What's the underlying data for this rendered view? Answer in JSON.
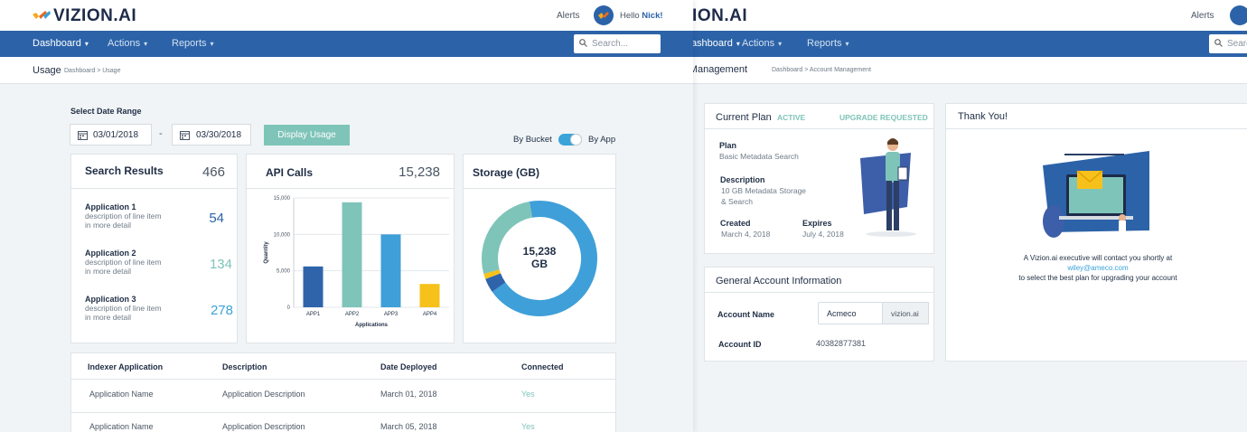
{
  "left": {
    "brand": "VIZION.AI",
    "alerts": "Alerts",
    "greeting_prefix": "Hello ",
    "greeting_name": "Nick!",
    "nav": [
      "Dashboard",
      "Actions",
      "Reports"
    ],
    "search_placeholder": "Search...",
    "page_title": "Usage",
    "breadcrumb": "Dashboard > Usage",
    "date_range_label": "Select Date Range",
    "date_start": "03/01/2018",
    "date_sep": "-",
    "date_end": "03/30/2018",
    "display_button": "Display Usage",
    "toggle_left": "By Bucket",
    "toggle_right": "By App",
    "search_results": {
      "title": "Search Results",
      "total": "466",
      "items": [
        {
          "name": "Application 1",
          "desc1": "description of line item",
          "desc2": "in more detail",
          "value": "54"
        },
        {
          "name": "Application 2",
          "desc1": "description of line item",
          "desc2": "in more detail",
          "value": "134"
        },
        {
          "name": "Application 3",
          "desc1": "description of line item",
          "desc2": "in more detail",
          "value": "278"
        }
      ]
    },
    "api_calls": {
      "title": "API Calls",
      "total": "15,238"
    },
    "storage": {
      "title": "Storage (GB)",
      "center_value": "15,238",
      "center_unit": "GB"
    },
    "table": {
      "headers": [
        "Indexer Application",
        "Description",
        "Date Deployed",
        "Connected"
      ],
      "rows": [
        [
          "Application Name",
          "Application Description",
          "March 01, 2018",
          "Yes"
        ],
        [
          "Application Name",
          "Application Description",
          "March 05, 2018",
          "Yes"
        ]
      ]
    }
  },
  "chart_data": [
    {
      "type": "bar",
      "categories": [
        "APP1",
        "APP2",
        "APP3",
        "APP4"
      ],
      "values": [
        5600,
        14400,
        10000,
        3200
      ],
      "colors": [
        "#2f64ab",
        "#7fc4b9",
        "#3f9fd8",
        "#f7c11c"
      ],
      "xlabel": "Applications",
      "ylabel": "Quantity",
      "ylim": [
        0,
        15000
      ],
      "yticks": [
        "0",
        "5,000",
        "10,000",
        "15,000"
      ],
      "grid": true
    },
    {
      "type": "pie",
      "values": [
        68,
        4,
        1.5,
        26.5
      ],
      "colors": [
        "#3f9fd8",
        "#2f64ab",
        "#f7c11c",
        "#7fc4b9"
      ]
    }
  ],
  "right": {
    "brand": "VIZION.AI",
    "alerts": "Alerts",
    "nav": [
      "Dashboard",
      "Actions",
      "Reports"
    ],
    "search_placeholder": "Search",
    "page_title": "Account Management",
    "breadcrumb": "Dashboard > Account Management",
    "plan": {
      "title": "Current Plan",
      "status": "ACTIVE",
      "upgrade": "UPGRADE REQUESTED",
      "plan_label": "Plan",
      "plan_value": "Basic Metadata Search",
      "desc_label": "Description",
      "desc_line1": "10 GB Metadata Storage",
      "desc_line2": "& Search",
      "created_label": "Created",
      "created_value": "March 4, 2018",
      "expires_label": "Expires",
      "expires_value": "July 4, 2018"
    },
    "general": {
      "title": "General Account Information",
      "name_label": "Account Name",
      "name_value": "Acmeco",
      "domain_suffix": "vizion.ai",
      "id_label": "Account ID",
      "id_value": "40382877381"
    },
    "thanks": {
      "title": "Thank You!",
      "line1": "A Vizion.ai executive will contact you shortly at",
      "email": "wiley@ameco.com",
      "line2": "to select the best plan for upgrading your account"
    }
  },
  "colors": {
    "nav": "#2c63a8",
    "accent": "#7fc4b9",
    "link": "#3aa3d8"
  }
}
